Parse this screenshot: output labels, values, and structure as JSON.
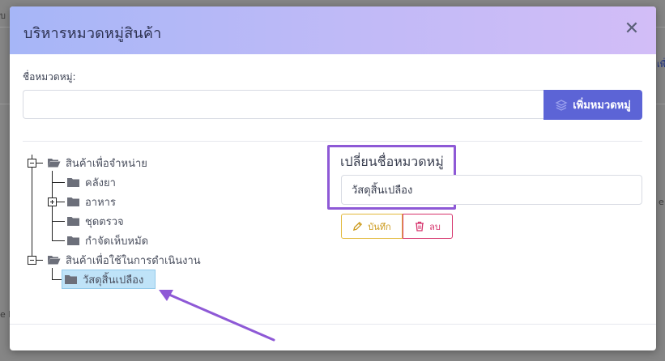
{
  "background": {
    "left_text": "บ",
    "left_text_2": "e H",
    "right_link": "เพื่",
    "right_text": "e"
  },
  "modal": {
    "title": "บริหารหมวดหมู่สินค้า",
    "close_icon": "close-icon",
    "category_label": "ชื่อหมวดหมู่:",
    "category_input_value": "",
    "add_button_label": "เพิ่มหมวดหมู่",
    "add_button_icon": "layers-icon"
  },
  "tree": {
    "groups": [
      {
        "label": "สินค้าเพื่อจำหน่าย",
        "expanded": true,
        "children": [
          {
            "label": "คลังยา",
            "has_children": false
          },
          {
            "label": "อาหาร",
            "has_children": true
          },
          {
            "label": "ชุดตรวจ",
            "has_children": false
          },
          {
            "label": "กำจัดเห็บหมัด",
            "has_children": false
          }
        ]
      },
      {
        "label": "สินค้าเพื่อใช้ในการดำเนินงาน",
        "expanded": true,
        "children": [
          {
            "label": "วัสดุสิ้นเปลือง",
            "has_children": false,
            "selected": true
          }
        ]
      }
    ]
  },
  "edit_panel": {
    "title": "เปลี่ยนชื่อหมวดหมู่",
    "rename_value": "วัสดุสิ้นเปลือง",
    "save_label": "บันทึก",
    "save_icon": "pencil-icon",
    "delete_label": "ลบ",
    "delete_icon": "trash-icon"
  },
  "colors": {
    "header_gradient_start": "#a6b6f7",
    "header_gradient_end": "#d2bdf7",
    "primary": "#5c64d6",
    "highlight_box": "#8e59d6",
    "save": "#cc9a1c",
    "delete": "#d6336c",
    "selected_node": "#bfe3f8",
    "annotation_arrow": "#8e59d6"
  }
}
